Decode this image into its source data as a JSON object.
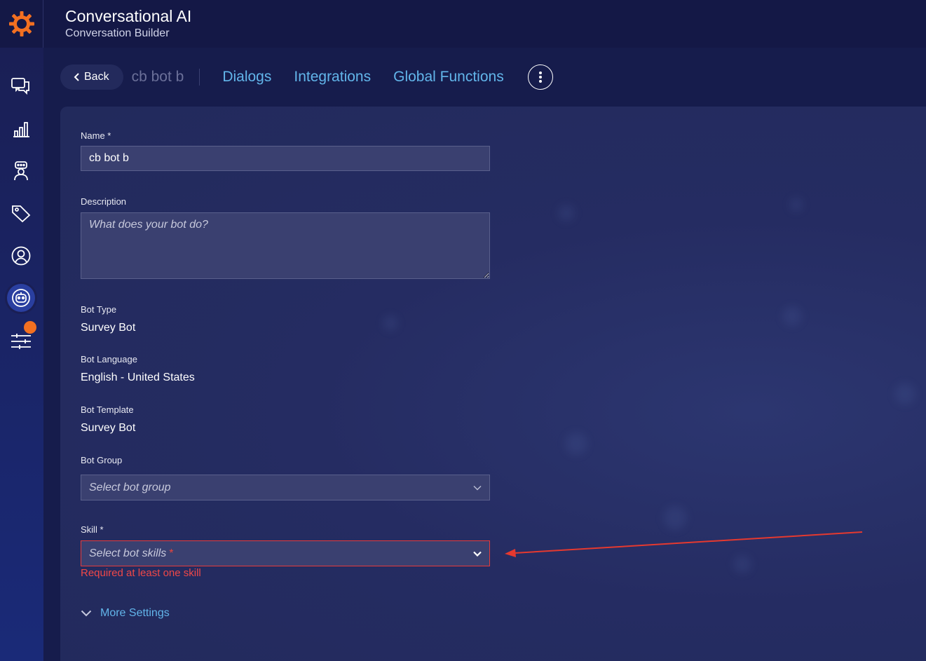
{
  "header": {
    "title": "Conversational AI",
    "subtitle": "Conversation Builder",
    "logo_icon": "sun-gear-icon",
    "logo_color": "#f37021"
  },
  "sidebar": {
    "items": [
      {
        "icon": "chat-bubbles-icon"
      },
      {
        "icon": "bar-chart-icon"
      },
      {
        "icon": "agent-icon"
      },
      {
        "icon": "tag-icon"
      },
      {
        "icon": "user-circle-icon"
      },
      {
        "icon": "bot-icon",
        "active": true
      },
      {
        "icon": "sliders-icon",
        "notification": true
      }
    ]
  },
  "nav": {
    "back_label": "Back",
    "bot_name": "cb bot b",
    "links": [
      "Dialogs",
      "Integrations",
      "Global Functions"
    ],
    "more_icon": "vertical-dots-icon"
  },
  "form": {
    "name": {
      "label": "Name *",
      "value": "cb bot b"
    },
    "description": {
      "label": "Description",
      "placeholder": "What does your bot do?"
    },
    "bot_type": {
      "label": "Bot Type",
      "value": "Survey Bot"
    },
    "bot_language": {
      "label": "Bot Language",
      "value": "English - United States"
    },
    "bot_template": {
      "label": "Bot Template",
      "value": "Survey Bot"
    },
    "bot_group": {
      "label": "Bot Group",
      "placeholder": "Select bot group"
    },
    "skill": {
      "label": "Skill *",
      "placeholder": "Select bot skills",
      "required_mark": "*",
      "error": "Required at least one skill"
    },
    "more_settings": "More Settings"
  },
  "colors": {
    "accent_link": "#62b5ea",
    "error": "#e53b3b",
    "annotation_arrow": "#e5392f"
  }
}
